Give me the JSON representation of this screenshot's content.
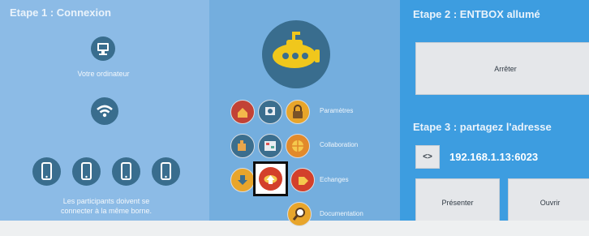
{
  "step1": {
    "title": "Etape 1 : Connexion",
    "computer_label": "Votre ordinateur",
    "note_line1": "Les participants doivent se",
    "note_line2": "connecter à la même borne."
  },
  "menu": {
    "items": [
      {
        "label": "Paramètres",
        "icon": "settings-icon"
      },
      {
        "label": "Collaboration",
        "icon": "collaboration-icon"
      },
      {
        "label": "Echanges",
        "icon": "exchange-icon"
      },
      {
        "label": "Documentation",
        "icon": "search-icon"
      }
    ]
  },
  "step2": {
    "title": "Etape 2 : ENTBOX allumé",
    "stop_button": "Arrêter"
  },
  "step3": {
    "title": "Etape 3 : partagez l'adresse",
    "toggle_label": "<>",
    "address": "192.168.1.13:6023",
    "present_button": "Présenter",
    "open_button": "Ouvrir"
  },
  "colors": {
    "panel_left": "#8cbbe6",
    "panel_middle": "#74aede",
    "panel_right": "#3d9de0",
    "icon_circle": "#396d8e",
    "submarine": "#f0c71c"
  }
}
